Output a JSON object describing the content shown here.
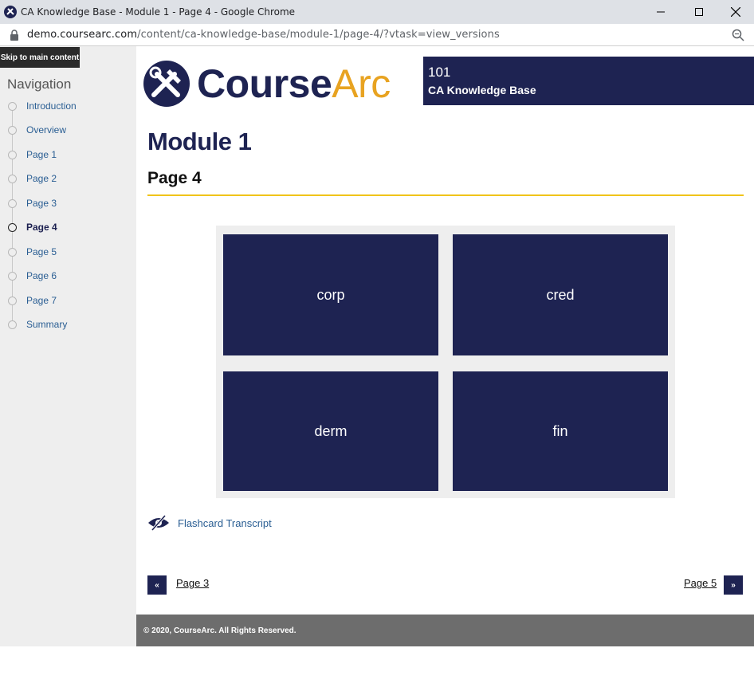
{
  "browser": {
    "tab_title": "CA Knowledge Base - Module 1 - Page 4 - Google Chrome",
    "url_host": "demo.coursearc.com",
    "url_path": "/content/ca-knowledge-base/module-1/page-4/?vtask=view_versions"
  },
  "skip_link": "Skip to main content",
  "sidebar": {
    "title": "Navigation",
    "items": [
      {
        "label": "Introduction",
        "active": false
      },
      {
        "label": "Overview",
        "active": false
      },
      {
        "label": "Page 1",
        "active": false
      },
      {
        "label": "Page 2",
        "active": false
      },
      {
        "label": "Page 3",
        "active": false
      },
      {
        "label": "Page 4",
        "active": true
      },
      {
        "label": "Page 5",
        "active": false
      },
      {
        "label": "Page 6",
        "active": false
      },
      {
        "label": "Page 7",
        "active": false
      },
      {
        "label": "Summary",
        "active": false
      }
    ]
  },
  "header": {
    "logo_text_course": "Course",
    "logo_text_arc": "Arc",
    "course_number": "101",
    "course_name": "CA Knowledge Base"
  },
  "main": {
    "module_title": "Module 1",
    "page_title": "Page 4",
    "flashcards": [
      "corp",
      "cred",
      "derm",
      "fin"
    ],
    "transcript_label": "Flashcard Transcript"
  },
  "pager": {
    "prev_label": "Page 3",
    "prev_symbol": "«",
    "next_label": "Page 5",
    "next_symbol": "»"
  },
  "footer": {
    "copyright": "© 2020, CourseArc. All Rights Reserved."
  },
  "colors": {
    "navy": "#1e2352",
    "gold": "#e8a321",
    "link": "#2a5e93",
    "rule": "#f0c419"
  }
}
